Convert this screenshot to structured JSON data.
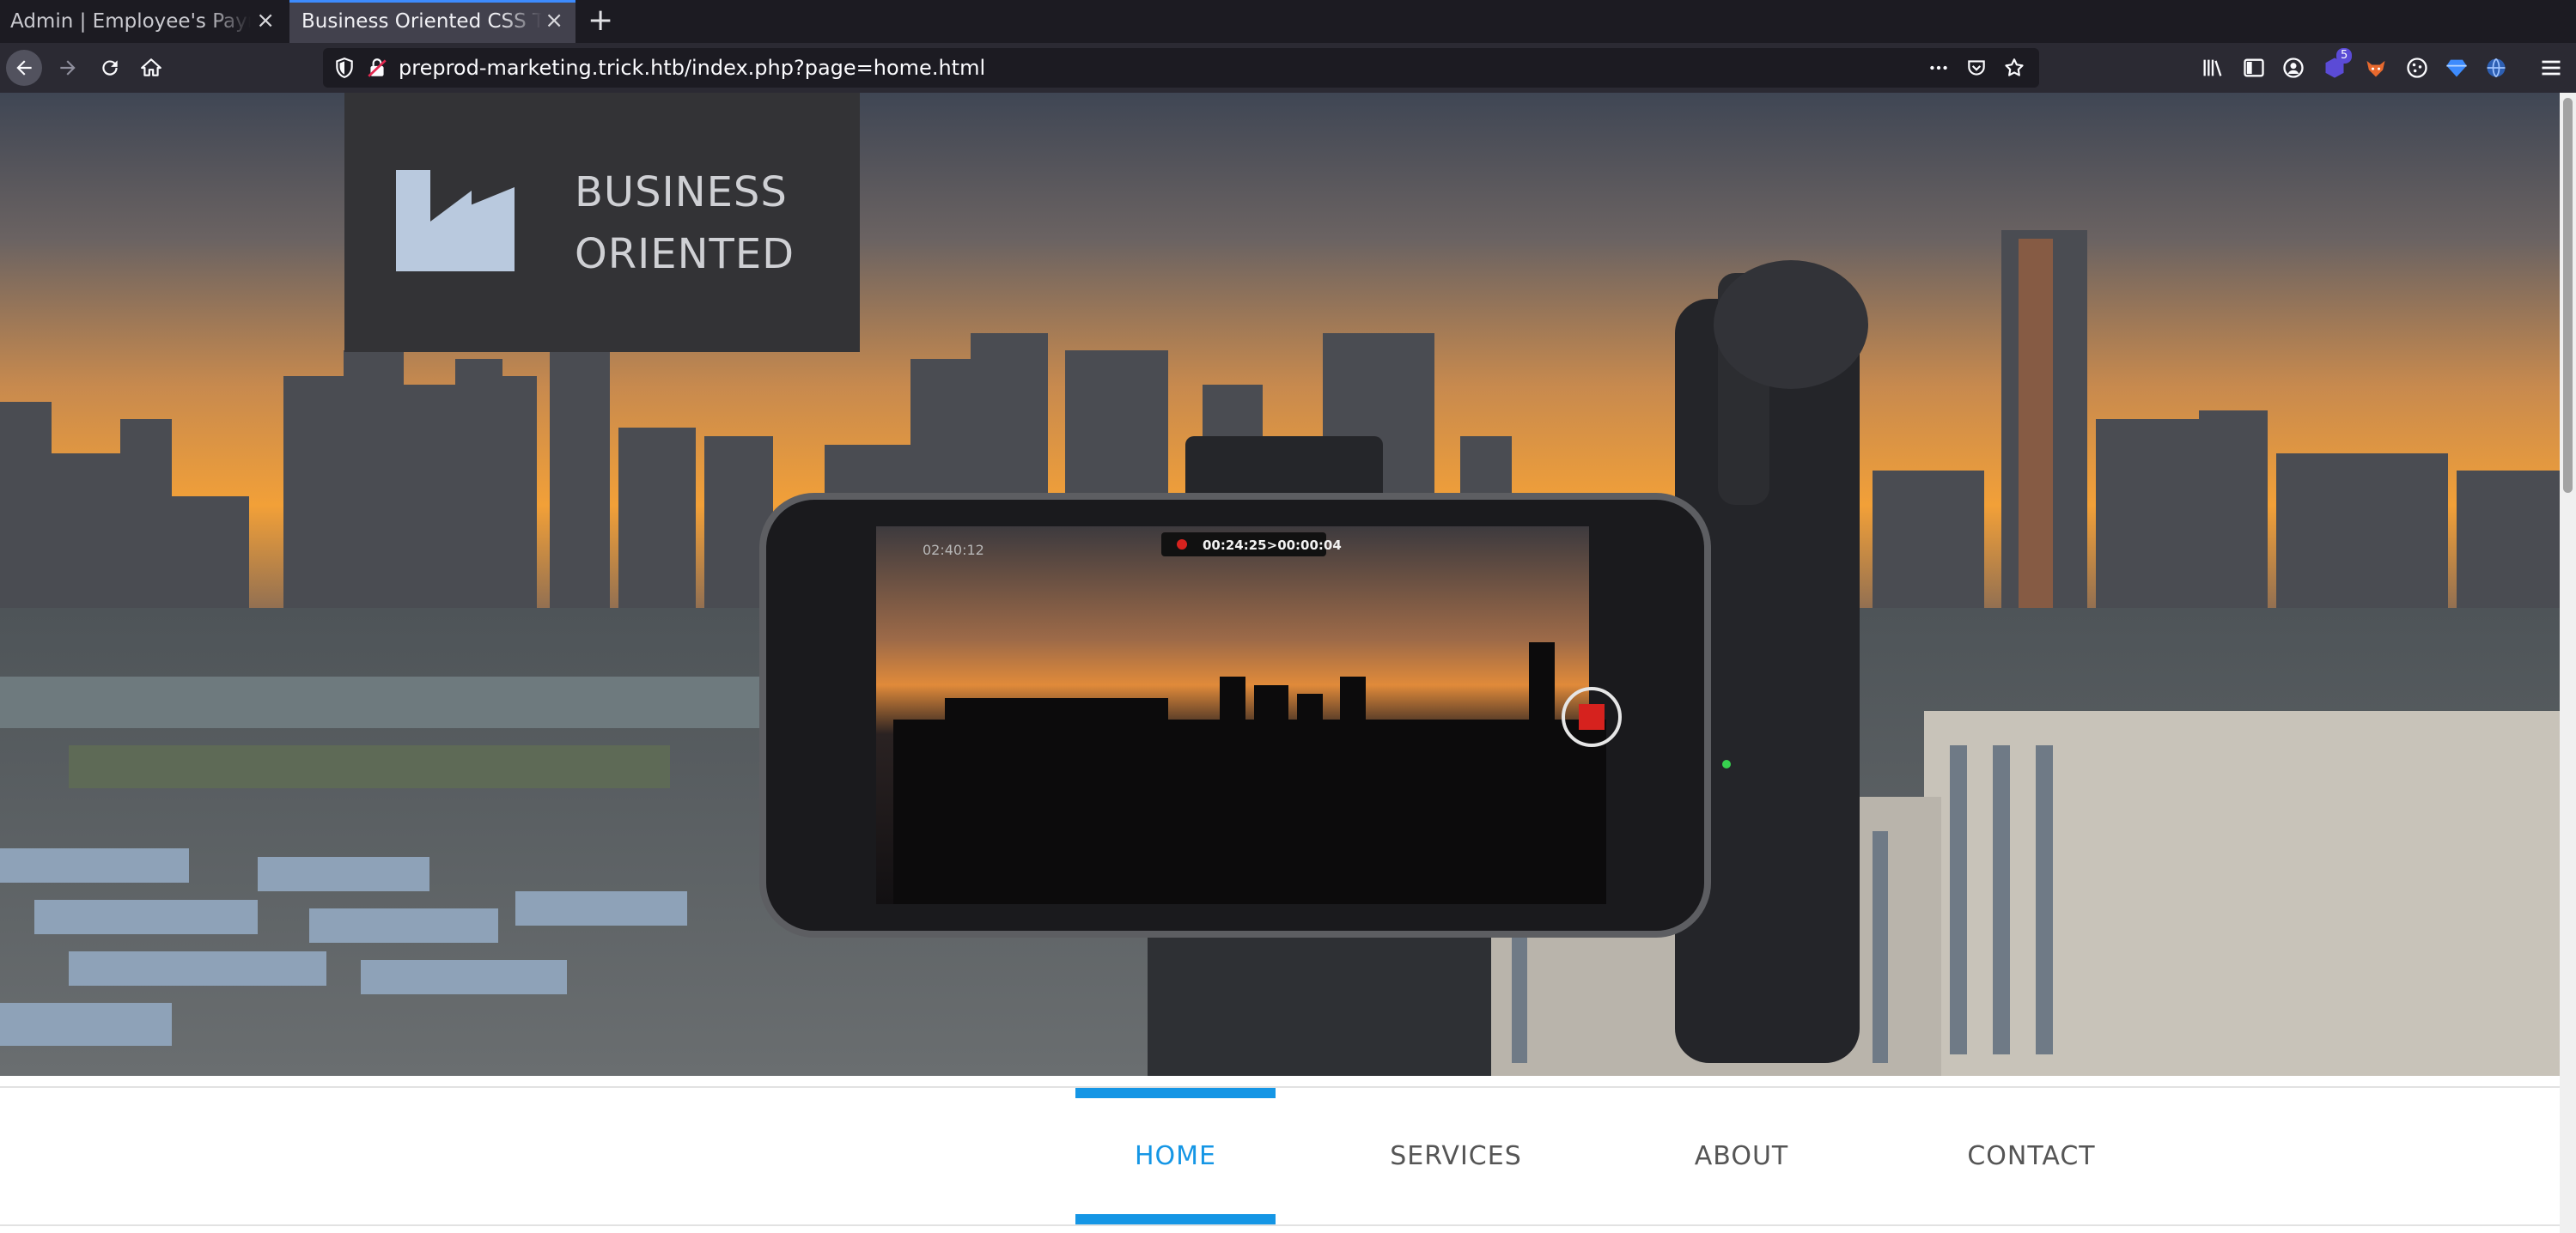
{
  "browser": {
    "tabs": [
      {
        "title": "Admin | Employee's Payroll",
        "active": false
      },
      {
        "title": "Business Oriented CSS Template",
        "active": true
      }
    ],
    "url": "preprod-marketing.trick.htb/index.php?page=home.html",
    "extension_badge": "5"
  },
  "site": {
    "logo_line1": "BUSINESS",
    "logo_line2": "ORIENTED",
    "hero_overlay": {
      "left_time": "02:40:12",
      "record_time": "00:24:25>00:00:04"
    },
    "menu": [
      {
        "label": "HOME",
        "active": true
      },
      {
        "label": "SERVICES",
        "active": false
      },
      {
        "label": "ABOUT",
        "active": false
      },
      {
        "label": "CONTACT",
        "active": false
      }
    ]
  },
  "colors": {
    "accent": "#1596e5",
    "tab_accent": "#3d8bfd",
    "logo_bg": "#333336"
  }
}
